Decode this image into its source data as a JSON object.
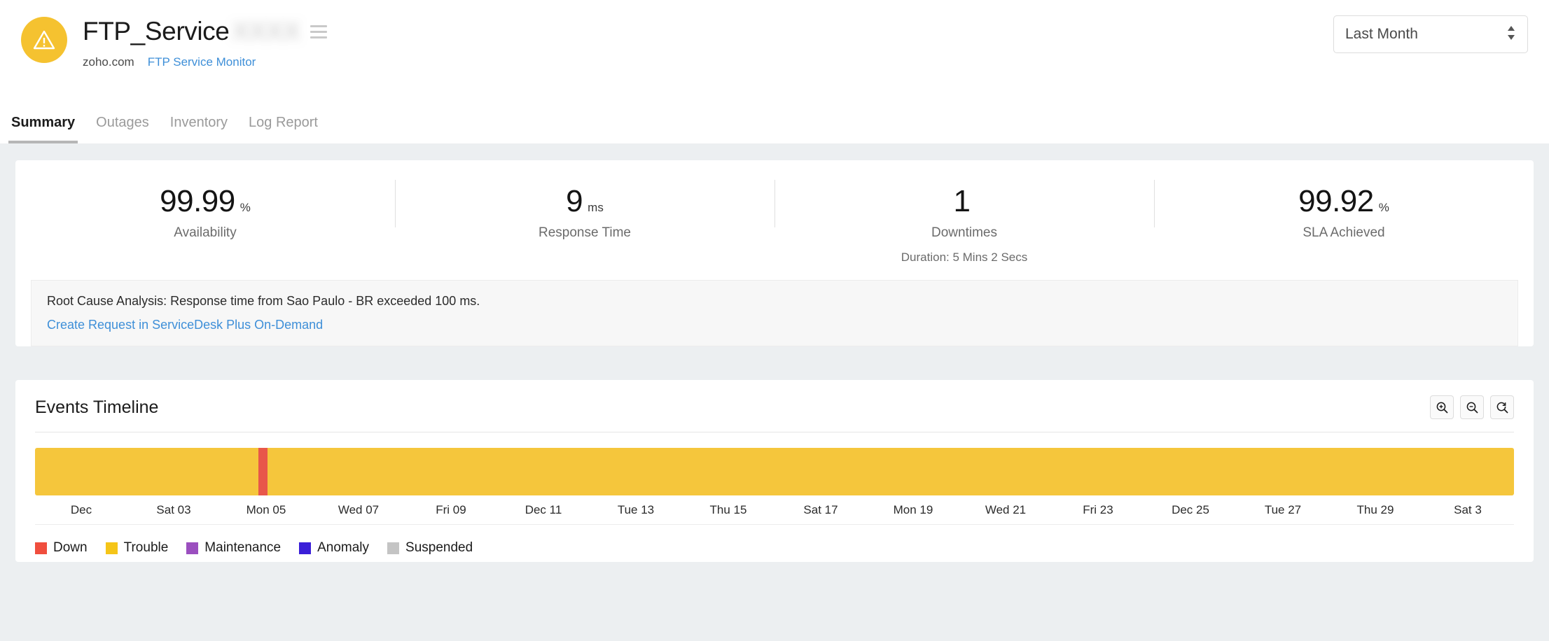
{
  "header": {
    "status_icon": "warning-triangle-icon",
    "status_color": "#F5C230",
    "monitor_title": "FTP_Service",
    "blurred_suffix": "XXXX",
    "menu_icon": "hamburger-menu-icon",
    "domain": "zoho.com",
    "monitor_type_link": "FTP Service Monitor",
    "period_selector": {
      "value": "Last Month",
      "options": [
        "Last Month"
      ]
    },
    "tabs": [
      {
        "label": "Summary",
        "active": true
      },
      {
        "label": "Outages",
        "active": false
      },
      {
        "label": "Inventory",
        "active": false
      },
      {
        "label": "Log Report",
        "active": false
      }
    ]
  },
  "stats": [
    {
      "value": "99.99",
      "unit": "%",
      "label": "Availability",
      "sub": ""
    },
    {
      "value": "9",
      "unit": "ms",
      "label": "Response Time",
      "sub": ""
    },
    {
      "value": "1",
      "unit": "",
      "label": "Downtimes",
      "sub": "Duration: 5 Mins 2 Secs"
    },
    {
      "value": "99.92",
      "unit": "%",
      "label": "SLA Achieved",
      "sub": ""
    }
  ],
  "rca": {
    "text": "Root Cause Analysis: Response time from Sao Paulo - BR exceeded 100 ms.",
    "link": "Create Request in ServiceDesk Plus On-Demand"
  },
  "timeline": {
    "title": "Events Timeline",
    "tools": [
      {
        "name": "zoom-in-icon"
      },
      {
        "name": "zoom-out-icon"
      },
      {
        "name": "zoom-reset-icon"
      }
    ],
    "base_color": "#F5C63C",
    "axis_labels": [
      "Dec",
      "Sat 03",
      "Mon 05",
      "Wed 07",
      "Fri 09",
      "Dec 11",
      "Tue 13",
      "Thu 15",
      "Sat 17",
      "Mon 19",
      "Wed 21",
      "Fri 23",
      "Dec 25",
      "Tue 27",
      "Thu 29",
      "Sat 3"
    ],
    "events": [
      {
        "type": "Down",
        "color": "#E8574A",
        "left_pct": 15.1,
        "width_pct": 0.62
      }
    ],
    "legend": [
      {
        "label": "Down",
        "color": "#F04E3E"
      },
      {
        "label": "Trouble",
        "color": "#F5C518"
      },
      {
        "label": "Maintenance",
        "color": "#9B4FBF"
      },
      {
        "label": "Anomaly",
        "color": "#3A1FD8"
      },
      {
        "label": "Suspended",
        "color": "#C4C4C4"
      }
    ]
  }
}
